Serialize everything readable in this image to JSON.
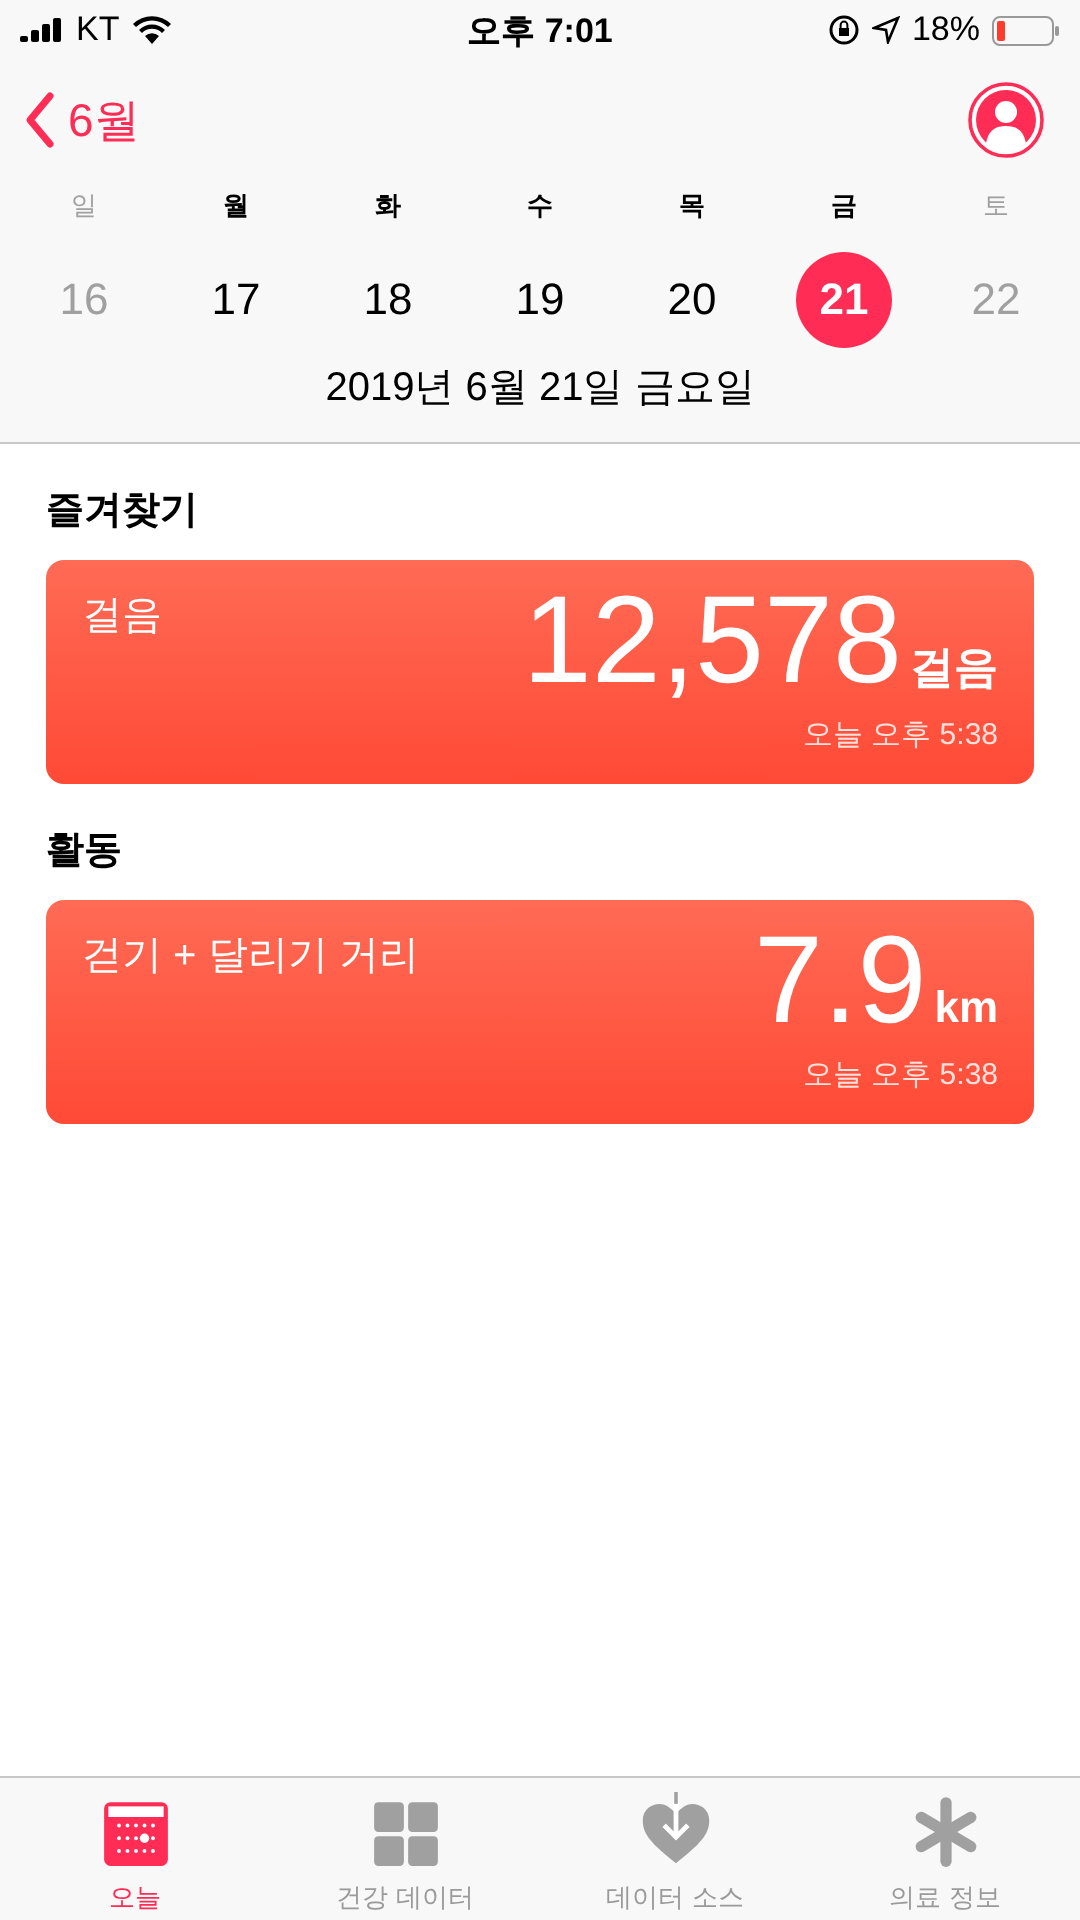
{
  "status_bar": {
    "carrier": "KT",
    "time": "오후 7:01",
    "battery": "18%"
  },
  "nav": {
    "back": "6월"
  },
  "week": [
    {
      "weekday": "일",
      "day": "16",
      "weekend": true,
      "selected": false
    },
    {
      "weekday": "월",
      "day": "17",
      "weekend": false,
      "selected": false
    },
    {
      "weekday": "화",
      "day": "18",
      "weekend": false,
      "selected": false
    },
    {
      "weekday": "수",
      "day": "19",
      "weekend": false,
      "selected": false
    },
    {
      "weekday": "목",
      "day": "20",
      "weekend": false,
      "selected": false
    },
    {
      "weekday": "금",
      "day": "21",
      "weekend": false,
      "selected": true
    },
    {
      "weekday": "토",
      "day": "22",
      "weekend": true,
      "selected": false
    }
  ],
  "date": "2019년 6월 21일 금요일",
  "sections": [
    {
      "title": "즐겨찾기",
      "cards": [
        {
          "label": "걸음",
          "value": "12,578",
          "unit": "걸음",
          "time": "오늘 오후 5:38"
        }
      ]
    },
    {
      "title": "활동",
      "cards": [
        {
          "label": "걷기 + 달리기 거리",
          "value": "7.9",
          "unit": "km",
          "time": "오늘 오후 5:38"
        }
      ]
    }
  ],
  "tabs": [
    {
      "kind": "today",
      "label": "오늘",
      "selected": true
    },
    {
      "kind": "data",
      "label": "건강 데이터",
      "selected": false
    },
    {
      "kind": "sources",
      "label": "데이터 소스",
      "selected": false
    },
    {
      "kind": "medical",
      "label": "의료 정보",
      "selected": false
    }
  ]
}
